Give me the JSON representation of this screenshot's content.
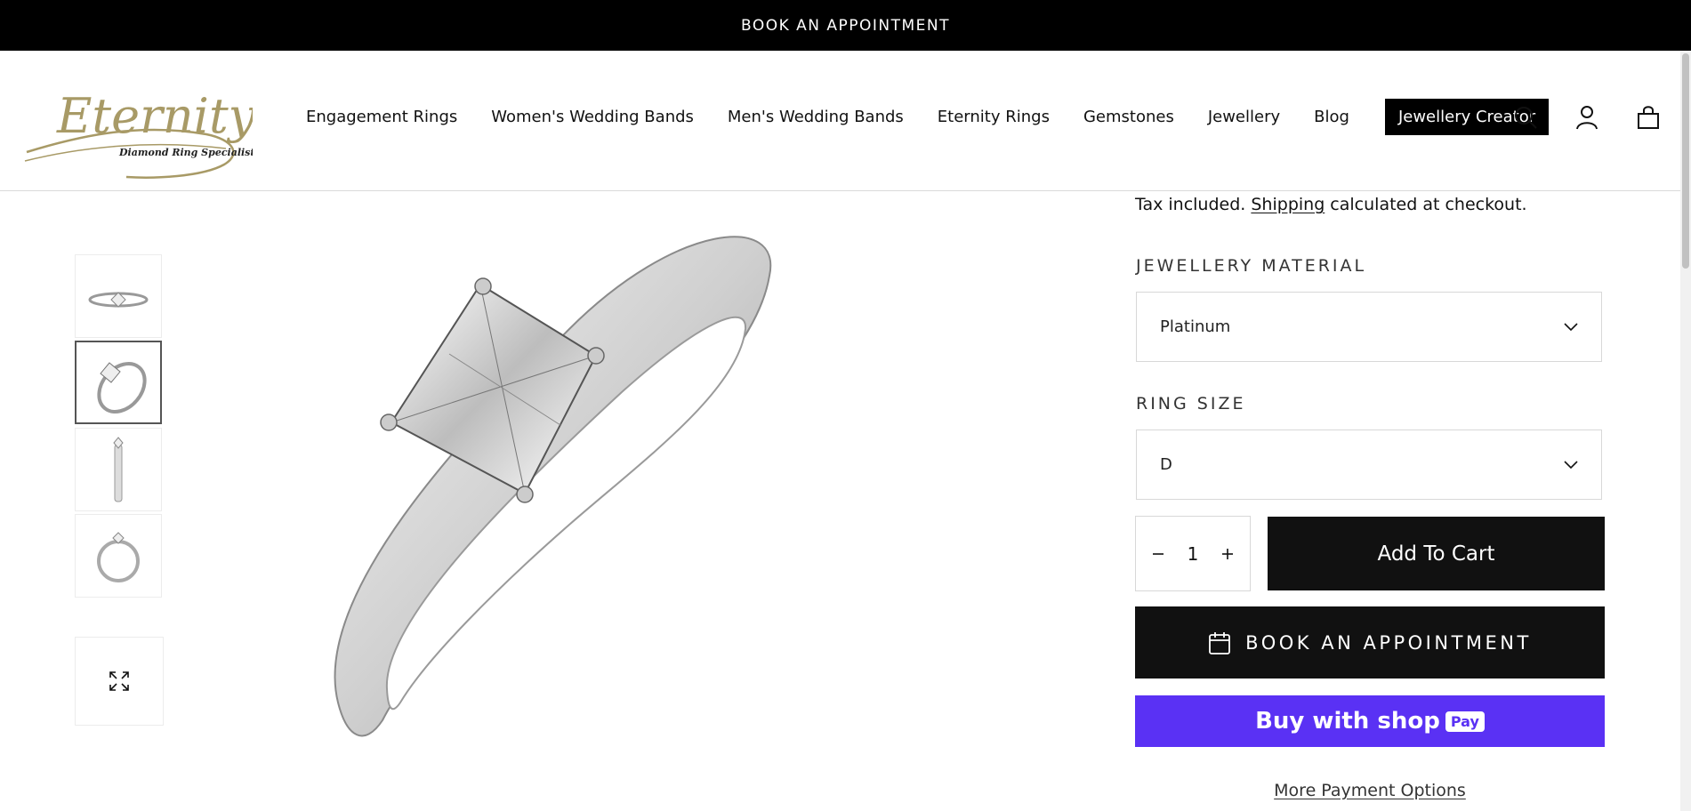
{
  "announcement": {
    "text": "BOOK AN APPOINTMENT"
  },
  "header": {
    "logo": {
      "brand": "Eternity",
      "tagline": "Diamond Ring Specialists"
    },
    "nav": [
      "Engagement Rings",
      "Women's Wedding Bands",
      "Men's Wedding Bands",
      "Eternity Rings",
      "Gemstones",
      "Jewellery",
      "Blog"
    ],
    "creator_label": "Jewellery Creator",
    "icons": [
      "search-icon",
      "account-icon",
      "cart-icon"
    ]
  },
  "gallery": {
    "thumbnails": [
      "ring-side-view",
      "ring-angled-view",
      "ring-profile-view",
      "ring-front-view"
    ],
    "active_thumbnail": 2
  },
  "product": {
    "tax_prefix": "Tax included. ",
    "tax_link": "Shipping",
    "tax_suffix": " calculated at checkout.",
    "material_label": "JEWELLERY MATERIAL",
    "material_value": "Platinum",
    "size_label": "RING SIZE",
    "size_value": "D",
    "quantity": "1",
    "add_to_cart": "Add To Cart",
    "book_appointment": "BOOK AN APPOINTMENT",
    "buy_with": "Buy with",
    "shop_word": "shop",
    "pay_badge": "Pay",
    "more_payment": "More Payment Options"
  },
  "colors": {
    "accent_black": "#111111",
    "shop_pay_purple": "#5a31f4",
    "logo_gold": "#a89a66"
  }
}
